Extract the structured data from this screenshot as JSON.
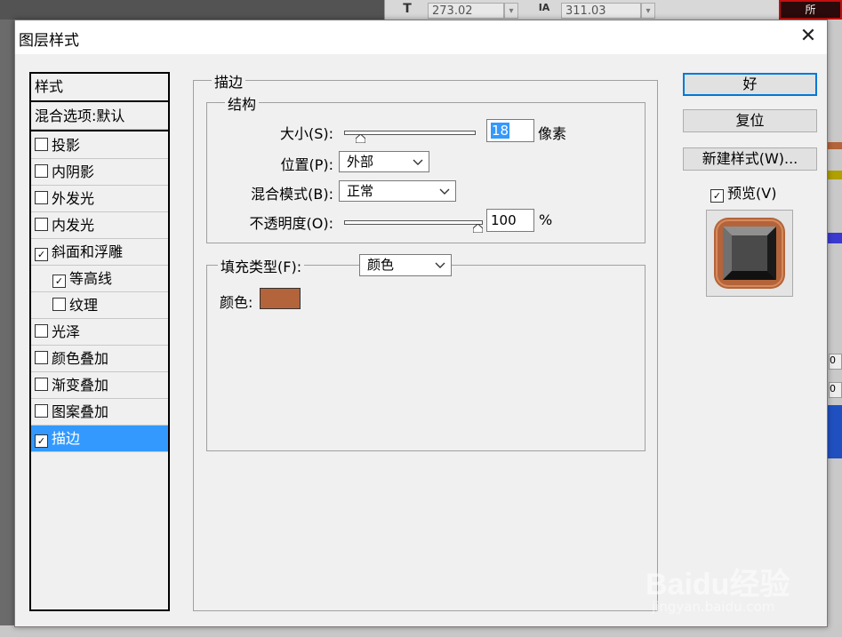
{
  "background": {
    "font_size_value": "273.02",
    "tracking_value": "311.03",
    "bg_text": "T",
    "bg_tracking_glyph": "IA",
    "bg_red_text": "所",
    "bg_right_values": [
      "0",
      "0"
    ]
  },
  "dialog": {
    "title": "图层样式",
    "close_glyph": "✕"
  },
  "styles_panel": {
    "header": "样式",
    "blend_options": "混合选项:默认",
    "items": [
      {
        "label": "投影",
        "checked": false,
        "indent": false,
        "selected": false
      },
      {
        "label": "内阴影",
        "checked": false,
        "indent": false,
        "selected": false
      },
      {
        "label": "外发光",
        "checked": false,
        "indent": false,
        "selected": false
      },
      {
        "label": "内发光",
        "checked": false,
        "indent": false,
        "selected": false
      },
      {
        "label": "斜面和浮雕",
        "checked": true,
        "indent": false,
        "selected": false
      },
      {
        "label": "等高线",
        "checked": true,
        "indent": true,
        "selected": false
      },
      {
        "label": "纹理",
        "checked": false,
        "indent": true,
        "selected": false
      },
      {
        "label": "光泽",
        "checked": false,
        "indent": false,
        "selected": false
      },
      {
        "label": "颜色叠加",
        "checked": false,
        "indent": false,
        "selected": false
      },
      {
        "label": "渐变叠加",
        "checked": false,
        "indent": false,
        "selected": false
      },
      {
        "label": "图案叠加",
        "checked": false,
        "indent": false,
        "selected": false
      },
      {
        "label": "描边",
        "checked": true,
        "indent": false,
        "selected": true
      }
    ]
  },
  "stroke": {
    "section_title": "描边",
    "structure_title": "结构",
    "size_label": "大小(S):",
    "size_value": "18",
    "size_unit": "像素",
    "position_label": "位置(P):",
    "position_value": "外部",
    "blend_label": "混合模式(B):",
    "blend_value": "正常",
    "opacity_label": "不透明度(O):",
    "opacity_value": "100",
    "opacity_unit": "%",
    "size_slider_level": 0.12,
    "opacity_slider_level": 1.0,
    "fill_type_label": "填充类型(F):",
    "fill_type_value": "颜色",
    "color_label": "颜色:",
    "color_hex": "#b3643a"
  },
  "buttons": {
    "ok": "好",
    "reset": "复位",
    "new_style": "新建样式(W)...",
    "preview_label": "预览(V)",
    "preview_checked": true
  },
  "colors": {
    "selection": "#3399ff",
    "default_button_border": "#0078d7",
    "stroke_color": "#b3643a"
  },
  "watermark": {
    "brand": "Baidu经验",
    "url": "jingyan.baidu.com"
  }
}
